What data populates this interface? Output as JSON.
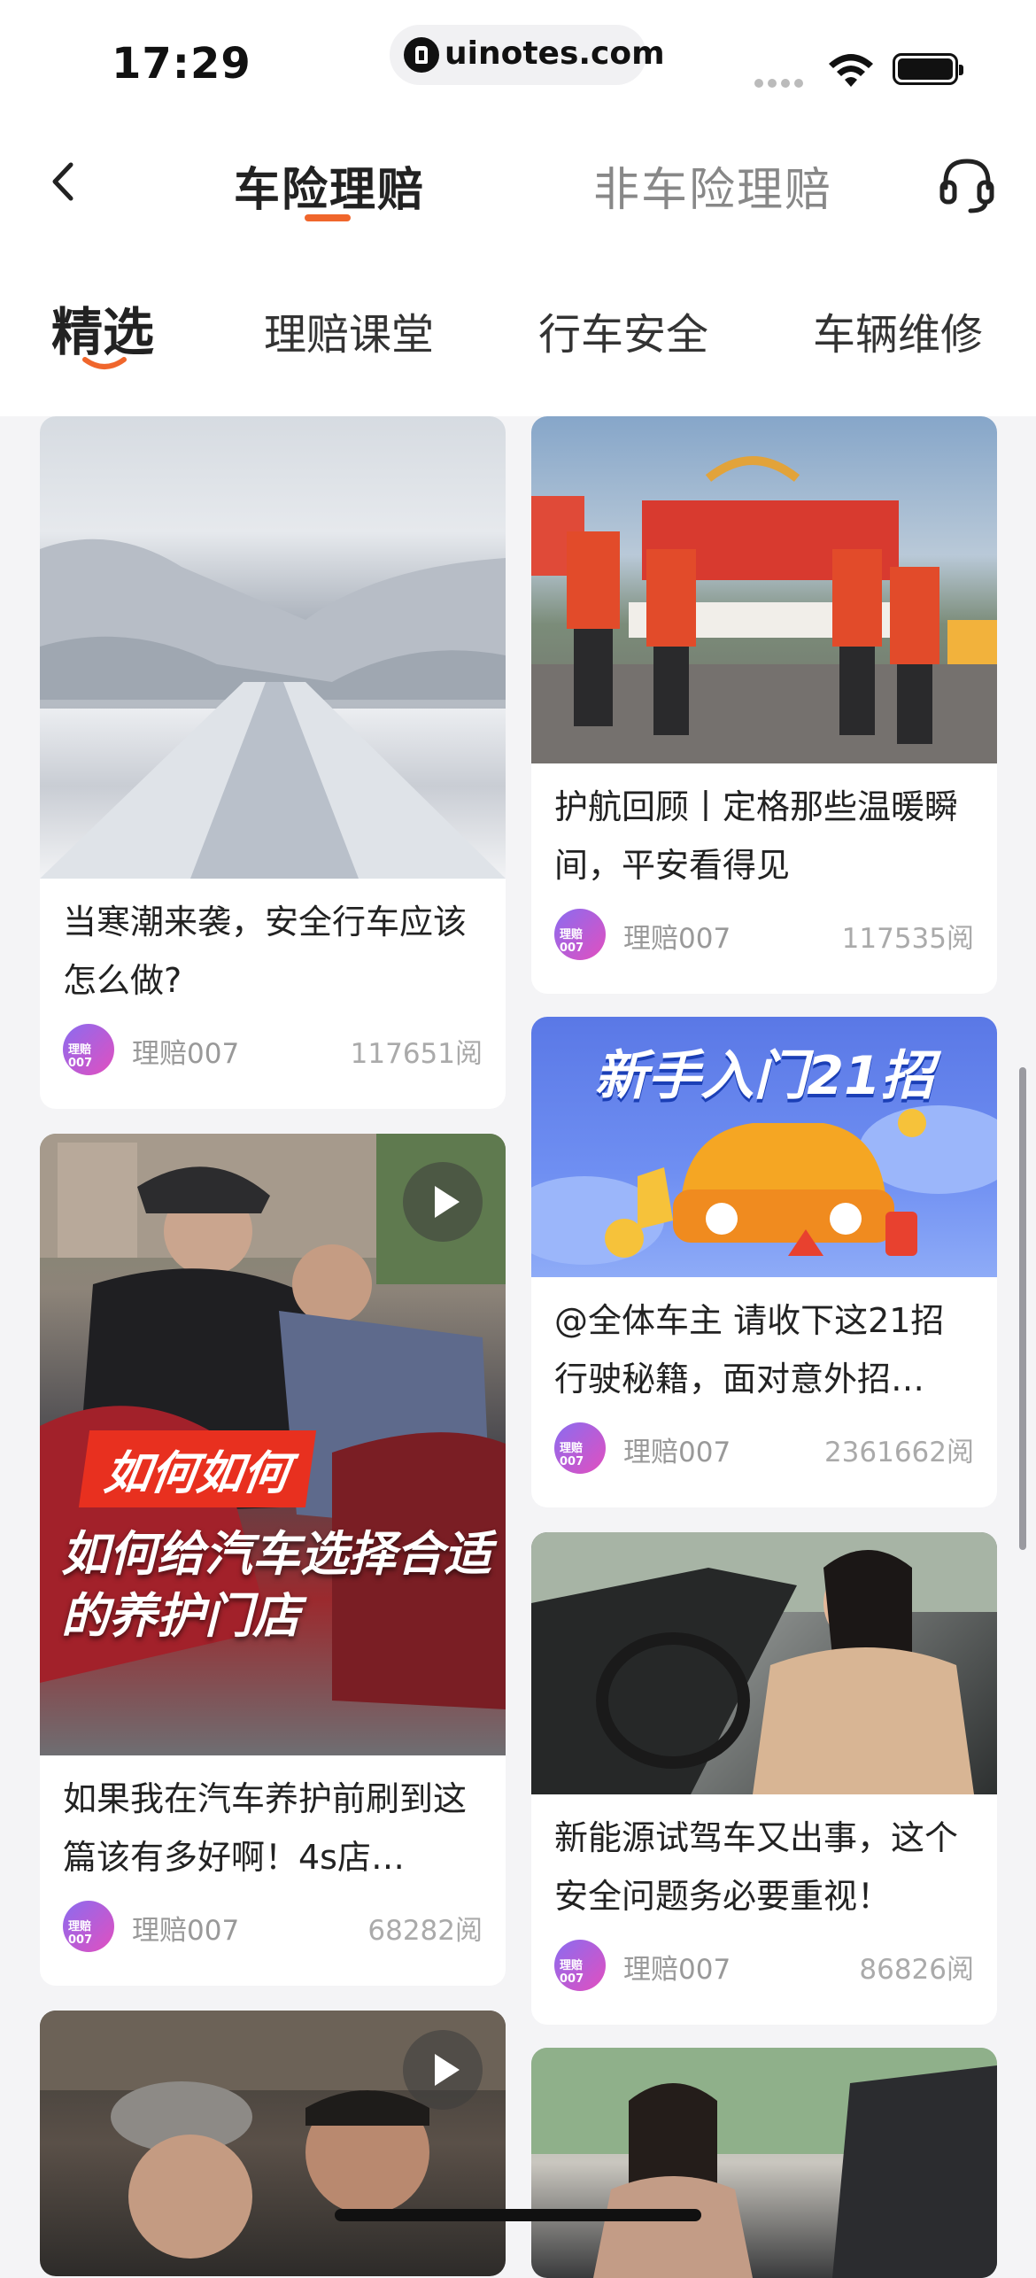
{
  "status_bar": {
    "time": "17:29",
    "url": "uinotes.com"
  },
  "header": {
    "tabs": [
      {
        "label": "车险理赔",
        "active": true
      },
      {
        "label": "非车险理赔",
        "active": false
      }
    ]
  },
  "categories": [
    {
      "label": "精选",
      "active": true
    },
    {
      "label": "理赔课堂",
      "active": false
    },
    {
      "label": "行车安全",
      "active": false
    },
    {
      "label": "车辆维修",
      "active": false
    }
  ],
  "accent_color": "#f0662c",
  "articles": [
    {
      "title": "当寒潮来袭，安全行车应该怎么做?",
      "author": "理赔007",
      "reads": "117651阅",
      "avatar_text": "理赔007",
      "type": "image"
    },
    {
      "title": "护航回顾丨定格那些温暖瞬间，平安看得见",
      "author": "理赔007",
      "reads": "117535阅",
      "avatar_text": "理赔007",
      "type": "image"
    },
    {
      "title": "@全体车主 请收下这21招行驶秘籍，面对意外招…",
      "author": "理赔007",
      "reads": "2361662阅",
      "avatar_text": "理赔007",
      "type": "image",
      "banner_text": "新手入门21招"
    },
    {
      "title": "如果我在汽车养护前刷到这篇该有多好啊！4s店…",
      "author": "理赔007",
      "reads": "68282阅",
      "avatar_text": "理赔007",
      "type": "video",
      "overlay_tag": "如何如何",
      "overlay_text": "如何给汽车选择合适的养护门店"
    },
    {
      "title": "新能源试驾车又出事，这个安全问题务必要重视！",
      "author": "理赔007",
      "reads": "86826阅",
      "avatar_text": "理赔007",
      "type": "image"
    }
  ]
}
